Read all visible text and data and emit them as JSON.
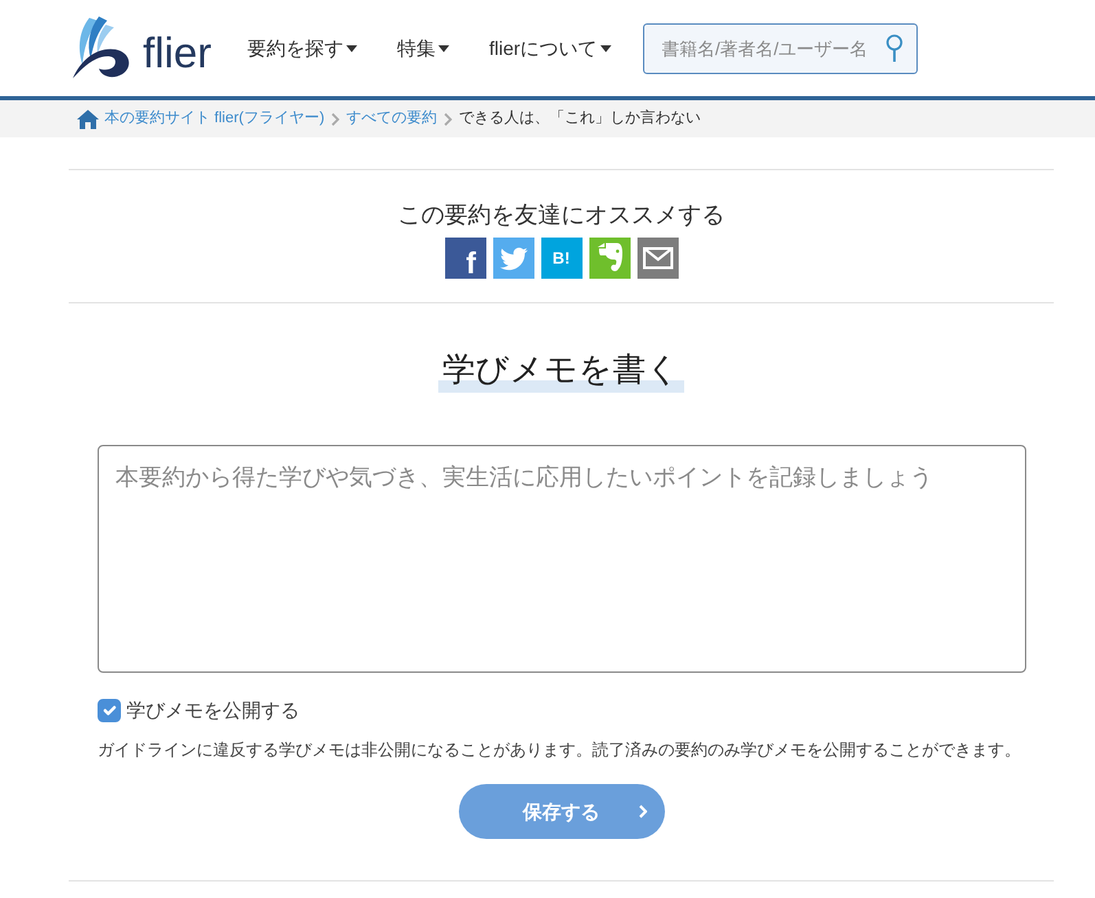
{
  "header": {
    "logo": {
      "text": "flier"
    },
    "nav": [
      {
        "label": "要約を探す",
        "dropdown": true
      },
      {
        "label": "特集",
        "dropdown": true
      },
      {
        "label": "flierについて",
        "dropdown": true
      }
    ],
    "search": {
      "placeholder": "書籍名/著者名/ユーザー名"
    }
  },
  "breadcrumb": [
    {
      "label": "本の要約サイト flier(フライヤー)",
      "kind": "home"
    },
    {
      "label": "すべての要約",
      "kind": "link"
    },
    {
      "label": "できる人は、「これ」しか言わない",
      "kind": "current"
    }
  ],
  "share": {
    "title": "この要約を友達にオススメする",
    "buttons": [
      {
        "kind": "facebook",
        "label": "f"
      },
      {
        "kind": "twitter"
      },
      {
        "kind": "hatena",
        "label": "B!"
      },
      {
        "kind": "evernote"
      },
      {
        "kind": "mail"
      }
    ]
  },
  "memo": {
    "title": "学びメモを書く",
    "field": {
      "placeholder": "本要約から得た学びや気づき、実生活に応用したいポイントを記録しましょう"
    },
    "publish": {
      "label": "学びメモを公開する",
      "checked": true
    },
    "note": "ガイドラインに違反する学びメモは非公開になることがあります。読了済みの要約のみ学びメモを公開することができます。",
    "save_button": {
      "label": "保存する"
    }
  }
}
